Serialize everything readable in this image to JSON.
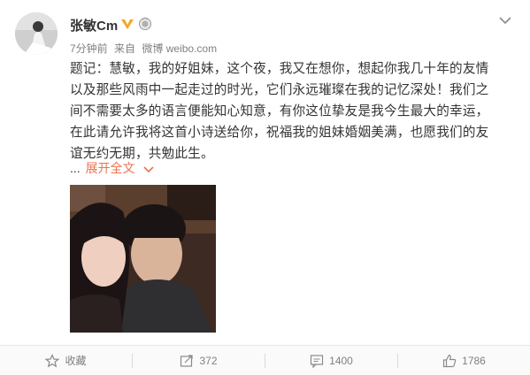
{
  "post": {
    "user_name": "张敏Cm",
    "time": "7分钟前",
    "source_prefix": "来自",
    "source_name": "微博 weibo.com",
    "text": "题记：慧敏，我的好姐妹，这个夜，我又在想你，想起你我几十年的友情以及那些风雨中一起走过的时光，它们永远璀璨在我的记忆深处！我们之间不需要太多的语言便能知心知意，有你这位挚友是我今生最大的幸运，在此请允许我将这首小诗送给你，祝福我的姐妹婚姻美满，也愿我们的友谊无约无期，共勉此生。",
    "ellipsis": "...",
    "expand_label": "展开全文"
  },
  "actions": {
    "favorite_label": "收藏",
    "repost_count": "372",
    "comment_count": "1400",
    "like_count": "1786"
  },
  "colors": {
    "link": "#eb7350",
    "vip": "#f5a623",
    "meta": "#808080"
  },
  "icons": [
    "vip-badge-icon",
    "medal-icon",
    "chevron-down-icon",
    "star-icon",
    "repost-icon",
    "comment-icon",
    "thumbs-up-icon"
  ]
}
